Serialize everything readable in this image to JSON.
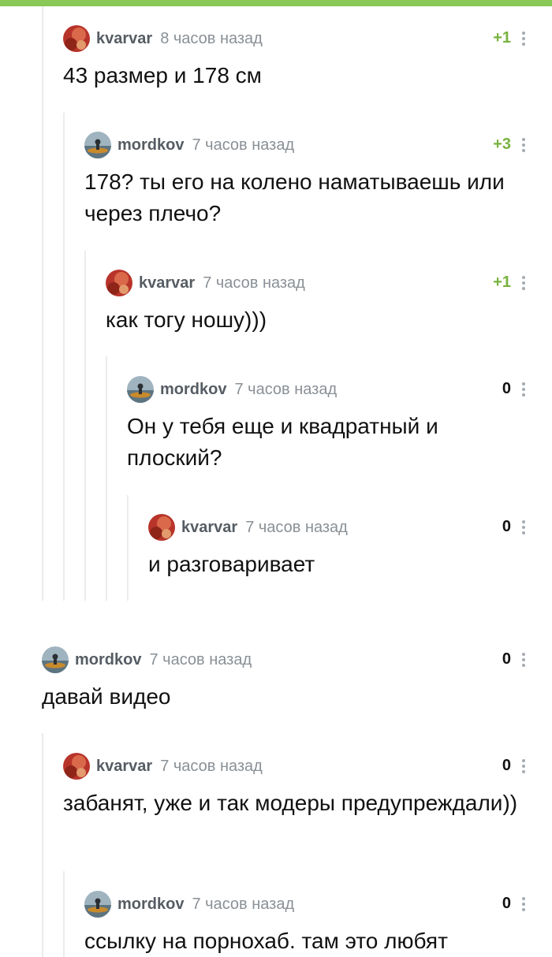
{
  "colors": {
    "accent": "#8ac858",
    "positive": "#78b23f",
    "thread_line": "#ececec"
  },
  "comments": [
    {
      "user": "kvarvar",
      "avatar": "kvarvar-avatar",
      "time": "8 часов назад",
      "rating": "+1",
      "text": "43 размер и 178 см"
    },
    {
      "user": "mordkov",
      "avatar": "mordkov-avatar",
      "time": "7 часов назад",
      "rating": "+3",
      "text": "178? ты его на колено наматываешь или через плечо?"
    },
    {
      "user": "kvarvar",
      "avatar": "kvarvar-avatar",
      "time": "7 часов назад",
      "rating": "+1",
      "text": "как тогу ношу)))"
    },
    {
      "user": "mordkov",
      "avatar": "mordkov-avatar",
      "time": "7 часов назад",
      "rating": "0",
      "text": "Он у тебя еще и квадратный и плоский?"
    },
    {
      "user": "kvarvar",
      "avatar": "kvarvar-avatar",
      "time": "7 часов назад",
      "rating": "0",
      "text": "и разговаривает"
    },
    {
      "user": "mordkov",
      "avatar": "mordkov-avatar",
      "time": "7 часов назад",
      "rating": "0",
      "text": "давай видео"
    },
    {
      "user": "kvarvar",
      "avatar": "kvarvar-avatar",
      "time": "7 часов назад",
      "rating": "0",
      "text": "забанят, уже и так модеры предупреждали))"
    },
    {
      "user": "mordkov",
      "avatar": "mordkov-avatar",
      "time": "7 часов назад",
      "rating": "0",
      "text": "ссылку на порнохаб. там это любят"
    }
  ]
}
